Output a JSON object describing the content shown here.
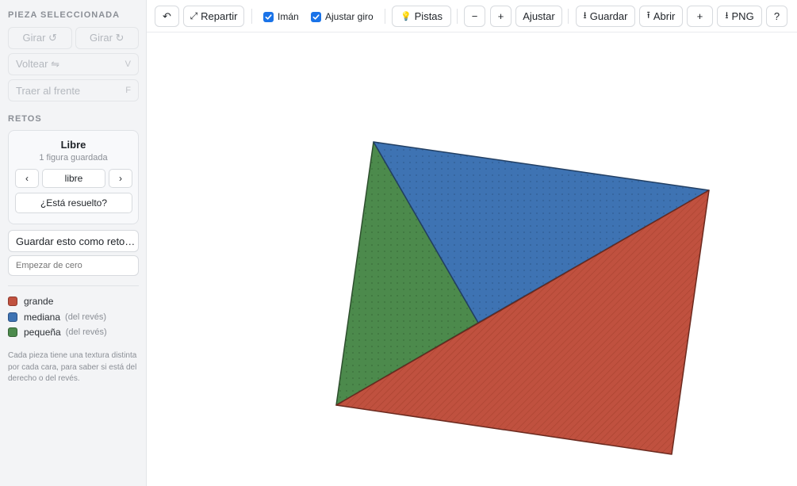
{
  "sidebar": {
    "selected_title": "PIEZA SELECCIONADA",
    "rotate_left_label": "Girar ↺",
    "rotate_right_label": "Girar ↻",
    "flip_label": "Voltear ⇋",
    "flip_key": "V",
    "front_label": "Traer al frente",
    "front_key": "F",
    "challenges_title": "RETOS",
    "card": {
      "title": "Libre",
      "subtitle": "1 figura guardada",
      "prev_label": "‹",
      "current_label": "libre",
      "next_label": "›",
      "solved_label": "¿Está resuelto?"
    },
    "save_challenge_label": "Guardar esto como reto…",
    "start_placeholder": "Empezar de cero",
    "legend": [
      {
        "label": "grande",
        "note": "",
        "color": "#c0513f"
      },
      {
        "label": "mediana",
        "note": "(del revés)",
        "color": "#3e73b3"
      },
      {
        "label": "pequeña",
        "note": "(del revés)",
        "color": "#4c8a4c"
      }
    ],
    "help_text": "Cada pieza tiene una textura distinta por cada cara, para saber si está del derecho o del revés."
  },
  "toolbar": {
    "undo_label": "↶",
    "shuffle_icon": "⤢",
    "shuffle_label": "Repartir",
    "magnet_label": "Imán",
    "snap_rotation_label": "Ajustar giro",
    "hints_icon": "💡",
    "hints_label": "Pistas",
    "zoom_out_label": "−",
    "zoom_in_label": "+",
    "fit_label": "Ajustar",
    "save_icon": "⭳",
    "save_label": "Guardar",
    "open_icon": "⭱",
    "open_label": "Abrir",
    "new_label": "+",
    "png_icon": "⭳",
    "png_label": "PNG",
    "help_label": "?"
  },
  "colors": {
    "large": "#c0513f",
    "medium": "#3e73b3",
    "small": "#4c8a4c",
    "accent": "#1a73e8"
  }
}
